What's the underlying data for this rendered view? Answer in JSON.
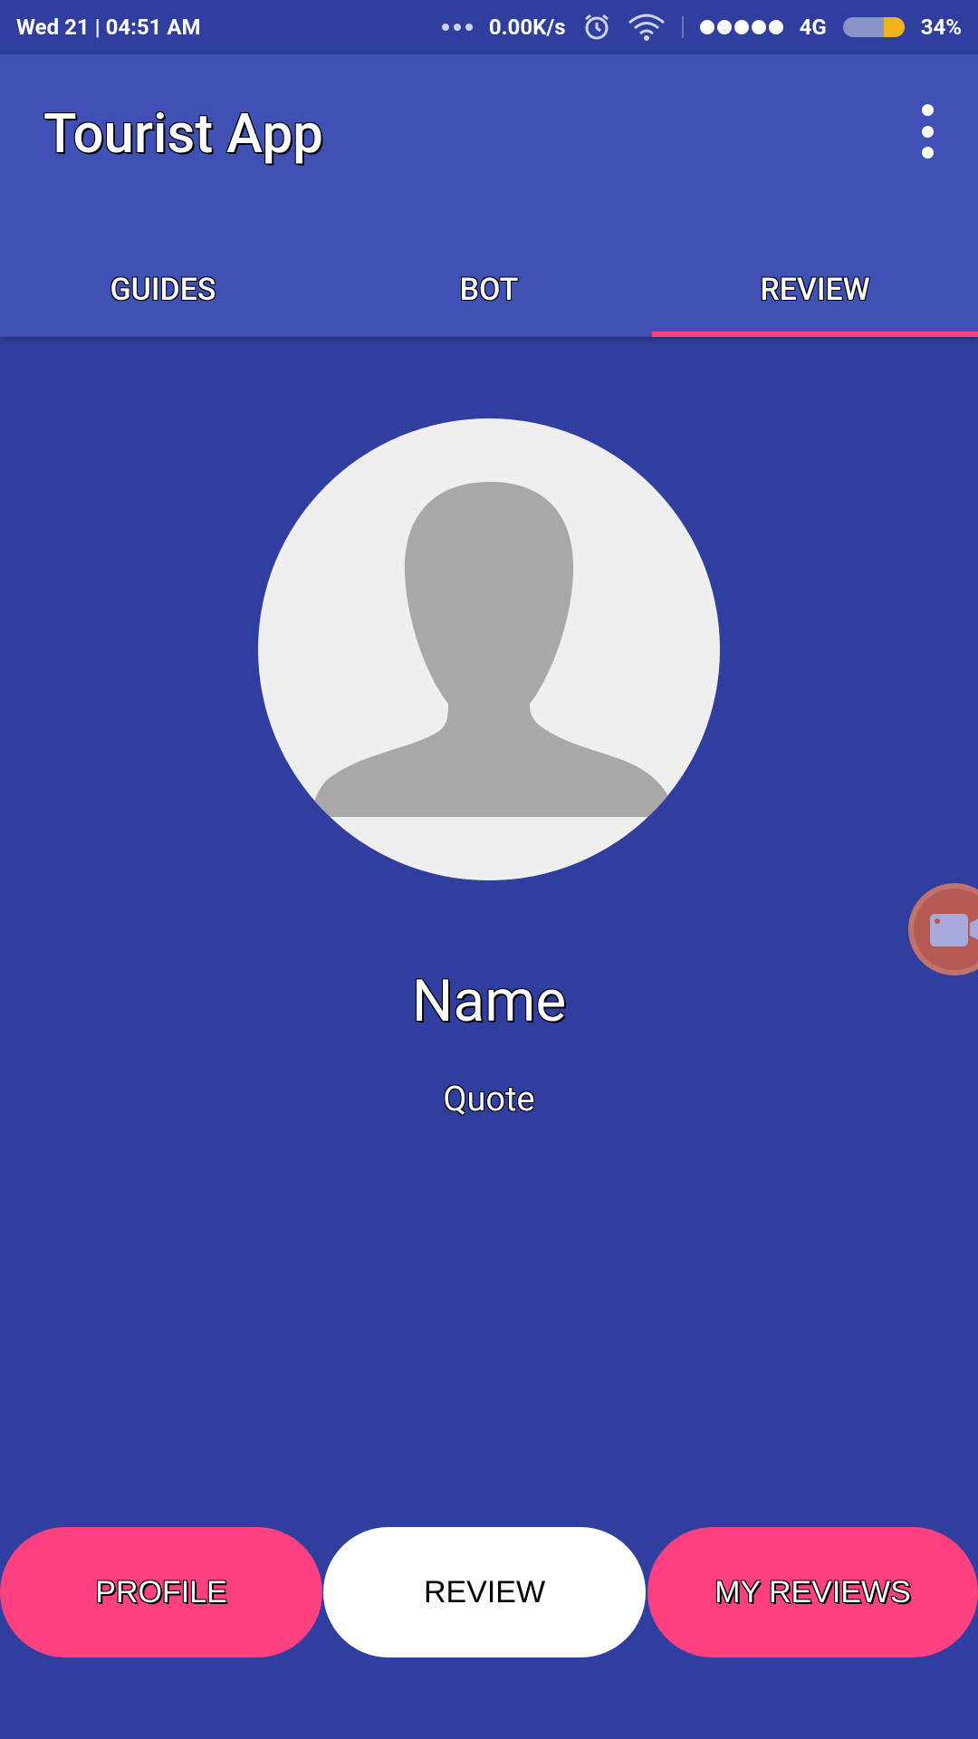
{
  "status_bar": {
    "datetime": "Wed 21 | 04:51 AM",
    "net_speed": "0.00K/s",
    "network_type": "4G",
    "battery": "34%"
  },
  "app_bar": {
    "title": "Tourist App",
    "tabs": [
      {
        "label": "GUIDES",
        "active": false
      },
      {
        "label": "BOT",
        "active": false
      },
      {
        "label": "REVIEW",
        "active": true
      }
    ]
  },
  "profile": {
    "name": "Name",
    "quote": "Quote"
  },
  "buttons": {
    "profile": "PROFILE",
    "review": "REVIEW",
    "my_reviews": "MY REVIEWS"
  },
  "colors": {
    "primary": "#3F51B5",
    "primary_dark": "#303F9F",
    "accent": "#FF4081"
  }
}
